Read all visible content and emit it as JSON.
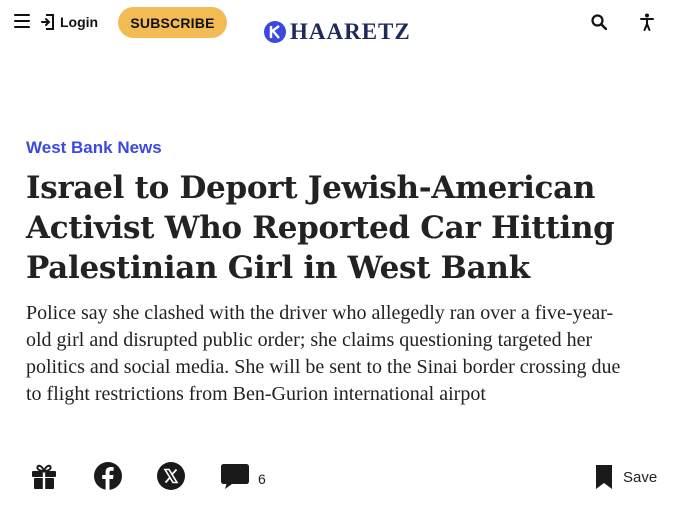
{
  "header": {
    "login_label": "Login",
    "subscribe_label": "SUBSCRIBE",
    "logo_text": "HAARETZ",
    "icons": [
      "menu-icon",
      "login-icon",
      "search-icon",
      "accessibility-icon"
    ]
  },
  "article": {
    "section": "West Bank News",
    "headline": "Israel to Deport Jewish-American Activist Who Reported Car Hitting Palestinian Girl in West Bank",
    "subtitle": "Police say she clashed with the driver who allegedly ran over a five-year-old girl and disrupted public order; she claims questioning targeted her politics and social media. She will be sent to the Sinai border crossing due to flight restrictions from Ben-Gurion international airpot"
  },
  "share_bar": {
    "comment_count": "6",
    "save_label": "Save",
    "icons": [
      "gift-icon",
      "facebook-icon",
      "x-icon",
      "comment-icon",
      "bookmark-icon"
    ]
  },
  "colors": {
    "subscribe_bg": "#f2bb54",
    "section_link": "#3b49df",
    "logo": "#1f2a5a",
    "text": "#222222"
  }
}
